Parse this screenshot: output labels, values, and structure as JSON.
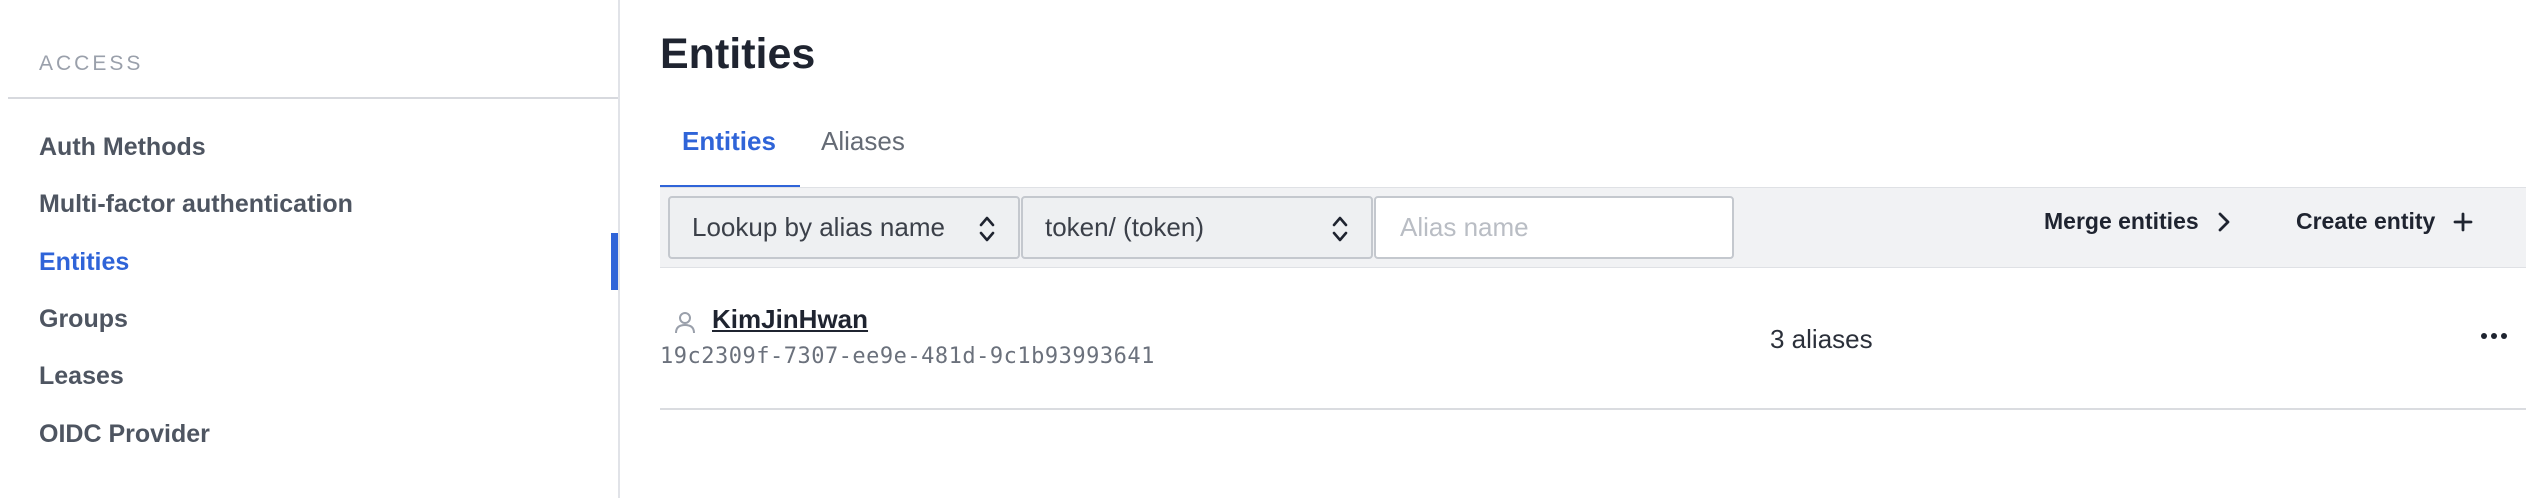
{
  "sidebar": {
    "heading": "ACCESS",
    "items": [
      {
        "label": "Auth Methods",
        "active": false
      },
      {
        "label": "Multi-factor authentication",
        "active": false
      },
      {
        "label": "Entities",
        "active": true
      },
      {
        "label": "Groups",
        "active": false
      },
      {
        "label": "Leases",
        "active": false
      },
      {
        "label": "OIDC Provider",
        "active": false
      }
    ]
  },
  "main": {
    "title": "Entities",
    "tabs": [
      {
        "label": "Entities",
        "active": true
      },
      {
        "label": "Aliases",
        "active": false
      }
    ],
    "toolbar": {
      "lookup_select": "Lookup by alias name",
      "mount_select": "token/ (token)",
      "alias_placeholder": "Alias name",
      "alias_value": "",
      "merge_label": "Merge entities",
      "create_label": "Create entity"
    },
    "entities": [
      {
        "name": "KimJinHwan",
        "id": "19c2309f-7307-ee9e-481d-9c1b93993641",
        "aliases": "3 aliases"
      }
    ]
  },
  "colors": {
    "accent": "#2f64d8",
    "toolbar_bg": "#f1f2f4"
  },
  "icons": [
    "updown-chevron-icon",
    "chevron-right-icon",
    "plus-icon",
    "person-icon",
    "ellipsis-icon"
  ]
}
